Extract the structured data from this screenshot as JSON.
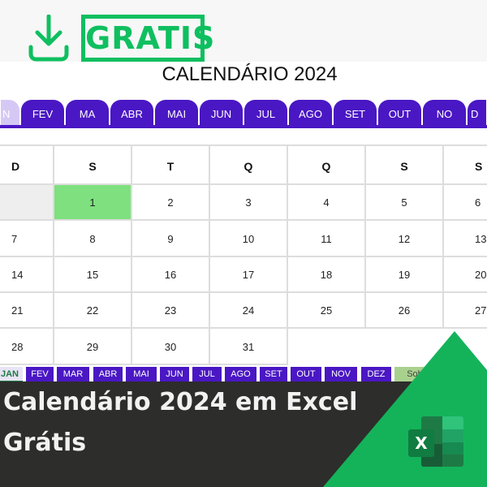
{
  "badge": {
    "label": "GRATIS"
  },
  "sheet": {
    "title": "CALENDÁRIO 2024"
  },
  "month_tabs": [
    "N",
    "FEV",
    "MA",
    "ABR",
    "MAI",
    "JUN",
    "JUL",
    "AGO",
    "SET",
    "OUT",
    "NO",
    "D"
  ],
  "weekdays": [
    "D",
    "S",
    "T",
    "Q",
    "Q",
    "S",
    "S"
  ],
  "weeks": [
    [
      "",
      "1",
      "2",
      "3",
      "4",
      "5",
      "6"
    ],
    [
      "7",
      "8",
      "9",
      "10",
      "11",
      "12",
      "13"
    ],
    [
      "14",
      "15",
      "16",
      "17",
      "18",
      "19",
      "20"
    ],
    [
      "21",
      "22",
      "23",
      "24",
      "25",
      "26",
      "27"
    ],
    [
      "28",
      "29",
      "30",
      "31",
      "",
      "",
      ""
    ]
  ],
  "highlight_day": "1",
  "sheet_tabs": [
    "JAN",
    "FEV",
    "MAR",
    "ABR",
    "MAI",
    "JUN",
    "JUL",
    "AGO",
    "SET",
    "OUT",
    "NOV",
    "DEZ",
    "Sob"
  ],
  "banner": {
    "line1": "Calendário 2024 em Excel",
    "line2": "Grátis",
    "excel_letter": "X"
  },
  "colors": {
    "purple": "#4a17c4",
    "green": "#0fbf5f",
    "highlight": "#7ee07e",
    "dark": "#2d2d2b"
  }
}
